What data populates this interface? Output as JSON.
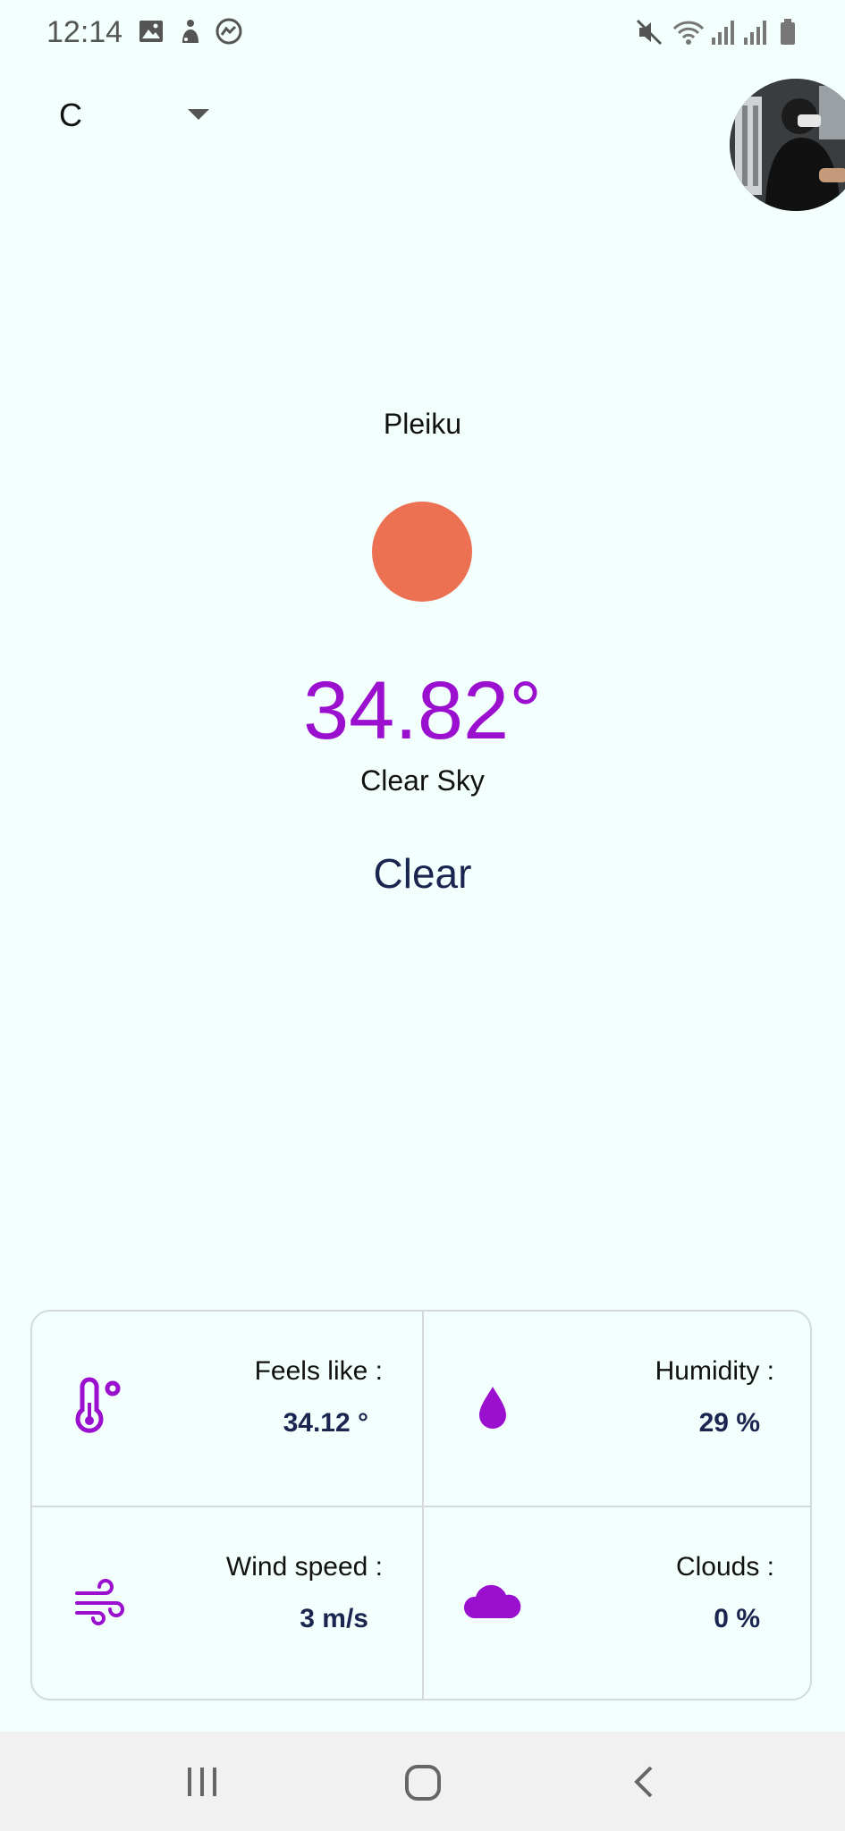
{
  "status_bar": {
    "time": "12:14",
    "left_icons": [
      "image-icon",
      "game-icon",
      "messenger-icon"
    ],
    "right_icons": [
      "mute-icon",
      "wifi-icon",
      "signal-icon",
      "signal-icon",
      "battery-icon"
    ]
  },
  "unit_selector": {
    "value": "C",
    "icon": "dropdown-arrow-icon"
  },
  "weather": {
    "city": "Pleiku",
    "icon": "sun-icon",
    "temperature": "34.82°",
    "description": "Clear Sky",
    "main": "Clear"
  },
  "stats": [
    {
      "label": "Feels like :",
      "value": "34.12 °",
      "icon": "thermometer-icon"
    },
    {
      "label": "Humidity :",
      "value": "29 %",
      "icon": "water-drop-icon"
    },
    {
      "label": "Wind speed :",
      "value": "3 m/s",
      "icon": "wind-icon"
    },
    {
      "label": "Clouds :",
      "value": "0 %",
      "icon": "cloud-icon"
    }
  ],
  "nav_bar": {
    "icons": [
      "recent-apps-icon",
      "home-icon",
      "back-icon"
    ]
  },
  "colors": {
    "background": "#f2fffd",
    "accent": "#9b0fcf",
    "sun": "#ec7152",
    "value_text": "#1a2550"
  }
}
